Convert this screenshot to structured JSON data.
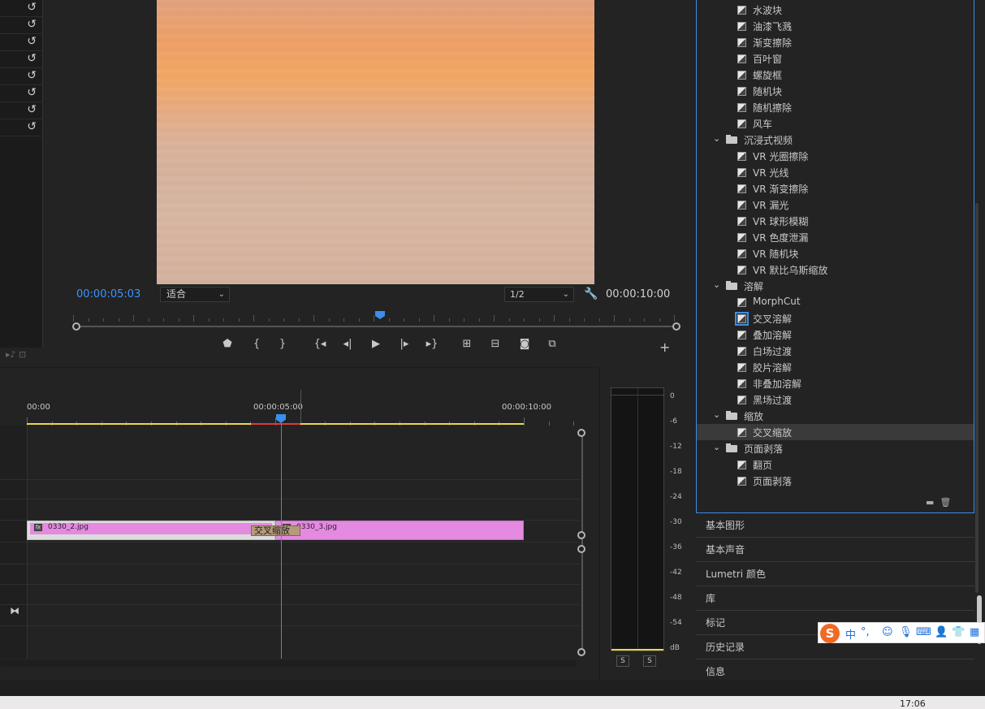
{
  "monitor": {
    "current_timecode": "00:00:05:03",
    "fit": "适合",
    "resolution": "1/2",
    "duration_timecode": "00:00:10:00"
  },
  "transport": [
    "marker-icon",
    "mark-in-icon",
    "mark-out-icon",
    "go-to-in-icon",
    "step-back-icon",
    "play-icon",
    "step-forward-icon",
    "go-to-out-icon",
    "lift-icon",
    "extract-icon",
    "camera-icon",
    "compare-icon"
  ],
  "timeline": {
    "ruler": [
      "00:00",
      "00:00:05:00",
      "00:00:10:00"
    ],
    "clips": [
      {
        "name": "0330_2.jpg",
        "fx": "fx"
      },
      {
        "name": "0330_3.jpg",
        "fx": "fx"
      }
    ],
    "transition": "交叉缩放"
  },
  "audio_meter": {
    "scale": [
      "0",
      "-6",
      "-12",
      "-18",
      "-24",
      "-30",
      "-36",
      "-42",
      "-48",
      "-54",
      "dB"
    ],
    "solo_left": "S",
    "solo_right": "S"
  },
  "effects": {
    "items": [
      {
        "type": "effect",
        "label": "水波块"
      },
      {
        "type": "effect",
        "label": "油漆飞溅"
      },
      {
        "type": "effect",
        "label": "渐变擦除"
      },
      {
        "type": "effect",
        "label": "百叶窗"
      },
      {
        "type": "effect",
        "label": "螺旋框"
      },
      {
        "type": "effect",
        "label": "随机块"
      },
      {
        "type": "effect",
        "label": "随机擦除"
      },
      {
        "type": "effect",
        "label": "风车"
      },
      {
        "type": "folder",
        "label": "沉浸式视频"
      },
      {
        "type": "effect",
        "label": "VR 光圈擦除"
      },
      {
        "type": "effect",
        "label": "VR 光线"
      },
      {
        "type": "effect",
        "label": "VR 渐变擦除"
      },
      {
        "type": "effect",
        "label": "VR 漏光"
      },
      {
        "type": "effect",
        "label": "VR 球形模糊"
      },
      {
        "type": "effect",
        "label": "VR 色度泄漏"
      },
      {
        "type": "effect",
        "label": "VR 随机块"
      },
      {
        "type": "effect",
        "label": "VR 默比乌斯缩放"
      },
      {
        "type": "folder",
        "label": "溶解"
      },
      {
        "type": "effect",
        "label": "MorphCut"
      },
      {
        "type": "effect",
        "label": "交叉溶解",
        "focus": true
      },
      {
        "type": "effect",
        "label": "叠加溶解"
      },
      {
        "type": "effect",
        "label": "白场过渡"
      },
      {
        "type": "effect",
        "label": "胶片溶解"
      },
      {
        "type": "effect",
        "label": "非叠加溶解"
      },
      {
        "type": "effect",
        "label": "黑场过渡"
      },
      {
        "type": "folder",
        "label": "缩放"
      },
      {
        "type": "effect",
        "label": "交叉缩放",
        "selected": true
      },
      {
        "type": "folder",
        "label": "页面剥落"
      },
      {
        "type": "effect",
        "label": "翻页"
      },
      {
        "type": "effect",
        "label": "页面剥落"
      }
    ]
  },
  "panels": [
    "基本图形",
    "基本声音",
    "Lumetri 颜色",
    "库",
    "标记",
    "历史记录",
    "信息"
  ],
  "ime": {
    "logo": "S",
    "mode": "中",
    "punct": "°,"
  },
  "taskbar": {
    "clock": "17:06"
  }
}
